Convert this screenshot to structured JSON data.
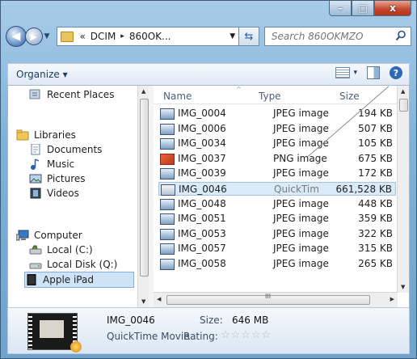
{
  "titlebar": {
    "minimize": "–",
    "maximize": "□",
    "close": "x"
  },
  "address": {
    "overflow": "«",
    "crumbs": [
      "DCIM",
      "860OK..."
    ],
    "separator": "▸"
  },
  "search": {
    "placeholder": "Search 860OKMZO"
  },
  "toolbar": {
    "organize_label": "Organize ▾",
    "view_drop": "▾",
    "help": "?"
  },
  "nav": {
    "recent_places": "Recent Places",
    "libraries": "Libraries",
    "documents": "Documents",
    "music": "Music",
    "pictures": "Pictures",
    "videos": "Videos",
    "computer": "Computer",
    "local_c": "Local (C:)",
    "local_q": "Local Disk (Q:)",
    "apple_ipad": "Apple iPad"
  },
  "columns": {
    "name": "Name",
    "type": "Type",
    "size": "Size"
  },
  "files": [
    {
      "name": "IMG_0004",
      "type": "JPEG image",
      "size": "194 KB"
    },
    {
      "name": "IMG_0006",
      "type": "JPEG image",
      "size": "507 KB"
    },
    {
      "name": "IMG_0034",
      "type": "JPEG image",
      "size": "105 KB"
    },
    {
      "name": "IMG_0037",
      "type": "PNG image",
      "size": "675 KB"
    },
    {
      "name": "IMG_0039",
      "type": "JPEG image",
      "size": "172 KB"
    },
    {
      "name": "IMG_0046",
      "type": "QuickTim",
      "size": "661,528 KB"
    },
    {
      "name": "IMG_0048",
      "type": "JPEG image",
      "size": "448 KB"
    },
    {
      "name": "IMG_0051",
      "type": "JPEG image",
      "size": "359 KB"
    },
    {
      "name": "IMG_0053",
      "type": "JPEG image",
      "size": "322 KB"
    },
    {
      "name": "IMG_0057",
      "type": "JPEG image",
      "size": "315 KB"
    },
    {
      "name": "IMG_0058",
      "type": "JPEG image",
      "size": "265 KB"
    }
  ],
  "scroll": {
    "grip": "III"
  },
  "details": {
    "name": "IMG_0046",
    "type": "QuickTime Movie",
    "size_label": "Size:",
    "size_value": "646 MB",
    "rating_label": "Rating:",
    "stars": "☆☆☆☆☆"
  }
}
